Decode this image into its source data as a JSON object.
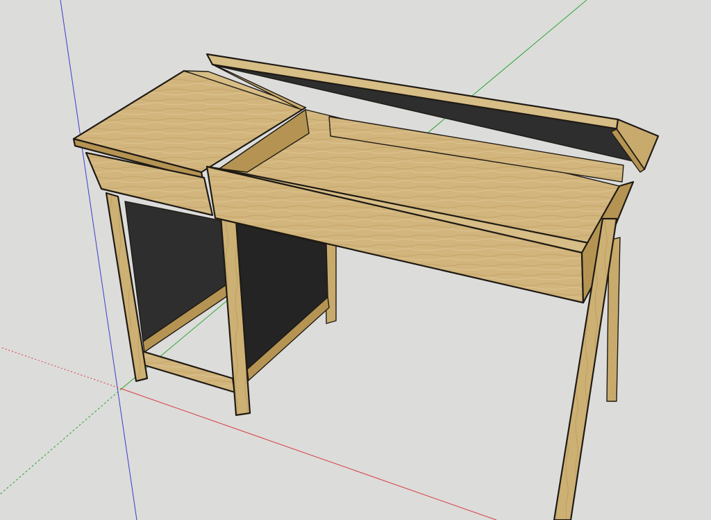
{
  "viewport": {
    "background": "#dcdcdb",
    "axes": {
      "red": "#d83a3a",
      "green": "#2aa52a",
      "blue": "#3a3ad0"
    }
  },
  "materials": {
    "wood_light": "#d7bd86",
    "wood_mid": "#c8aa6c",
    "wood_dark": "#b59453",
    "panel": "#2e2e2e",
    "panel_dark": "#242424"
  }
}
